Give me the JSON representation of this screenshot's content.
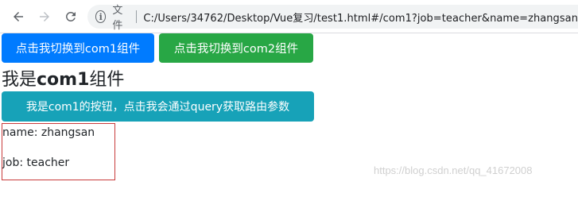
{
  "browser": {
    "url_scheme_label": "文件",
    "url": "C:/Users/34762/Desktop/Vue复习/test1.html#/com1?job=teacher&name=zhangsan",
    "icons": {
      "back": "arrow-left-icon",
      "forward": "arrow-right-icon",
      "reload": "reload-icon",
      "info": "info-icon"
    }
  },
  "page": {
    "button_com1": "点击我切换到com1组件",
    "button_com2": "点击我切换到com2组件",
    "heading_prefix": "我是",
    "heading_bold": "com1",
    "heading_suffix": "组件",
    "button_query": "我是com1的按钮，点击我会通过query获取路由参数",
    "params": {
      "name_line": "name: zhangsan",
      "job_line": "job: teacher"
    },
    "watermark": "https://blog.csdn.net/qq_41672008"
  },
  "colors": {
    "primary": "#007bff",
    "success": "#28a745",
    "info": "#17a2b8",
    "box_border": "#c93b3b"
  }
}
